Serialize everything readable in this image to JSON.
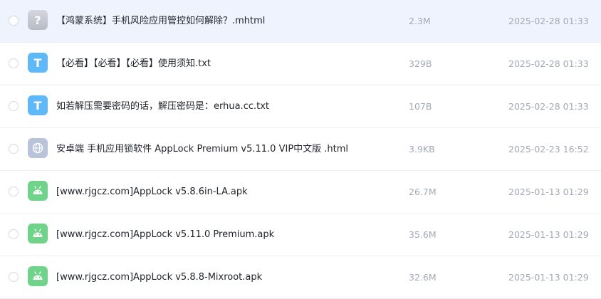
{
  "files": [
    {
      "name": "【鸿蒙系统】手机风险应用管控如何解除？.mhtml",
      "size": "2.3M",
      "date": "2025-02-28 01:33",
      "icon": "unknown-file-icon",
      "icon_glyph": "?"
    },
    {
      "name": "【必看】【必看】【必看】使用须知.txt",
      "size": "329B",
      "date": "2025-02-28 01:33",
      "icon": "txt-file-icon",
      "icon_glyph": "T"
    },
    {
      "name": "如若解压需要密码的话，解压密码是：erhua.cc.txt",
      "size": "107B",
      "date": "2025-02-28 01:33",
      "icon": "txt-file-icon",
      "icon_glyph": "T"
    },
    {
      "name": "安卓端 手机应用锁软件 AppLock Premium v5.11.0 VIP中文版 .html",
      "size": "3.9KB",
      "date": "2025-02-23 16:52",
      "icon": "globe-icon",
      "icon_glyph": ""
    },
    {
      "name": "[www.rjgcz.com]AppLock v5.8.6in-LA.apk",
      "size": "26.7M",
      "date": "2025-01-13 01:29",
      "icon": "android-icon",
      "icon_glyph": ""
    },
    {
      "name": "[www.rjgcz.com]AppLock v5.11.0 Premium.apk",
      "size": "35.6M",
      "date": "2025-01-13 01:29",
      "icon": "android-icon",
      "icon_glyph": ""
    },
    {
      "name": "[www.rjgcz.com]AppLock v5.8.8-Mixroot.apk",
      "size": "32.6M",
      "date": "2025-01-13 01:29",
      "icon": "android-icon",
      "icon_glyph": ""
    }
  ]
}
